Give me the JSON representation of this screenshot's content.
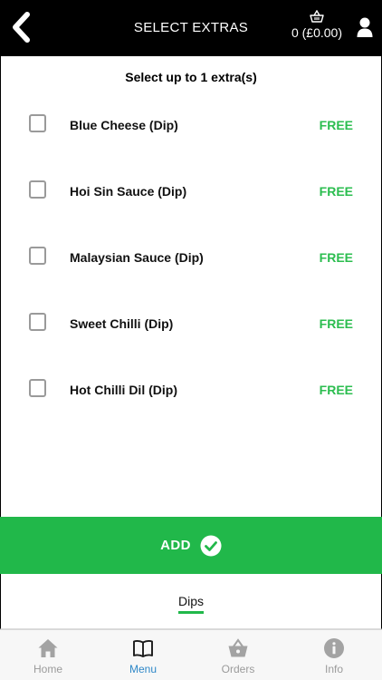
{
  "header": {
    "title": "SELECT EXTRAS",
    "basket_text": "0 (£0.00)",
    "back_icon": "chevron-left-icon",
    "basket_icon": "basket-icon",
    "user_icon": "user-icon"
  },
  "selection": {
    "subtitle": "Select up to 1 extra(s)",
    "extras": [
      {
        "name": "Blue Cheese (Dip)",
        "price": "FREE",
        "checked": false
      },
      {
        "name": "Hoi Sin Sauce (Dip)",
        "price": "FREE",
        "checked": false
      },
      {
        "name": "Malaysian Sauce (Dip)",
        "price": "FREE",
        "checked": false
      },
      {
        "name": "Sweet Chilli (Dip)",
        "price": "FREE",
        "checked": false
      },
      {
        "name": "Hot Chilli Dil (Dip)",
        "price": "FREE",
        "checked": false
      }
    ]
  },
  "add_button": {
    "label": "ADD",
    "icon": "check-circle-icon"
  },
  "category": {
    "label": "Dips"
  },
  "tabs": [
    {
      "label": "Home",
      "icon": "home-icon",
      "active": false
    },
    {
      "label": "Menu",
      "icon": "book-icon",
      "active": true
    },
    {
      "label": "Orders",
      "icon": "basket-icon",
      "active": false
    },
    {
      "label": "Info",
      "icon": "info-icon",
      "active": false
    }
  ],
  "colors": {
    "header_bg": "#000000",
    "accent_green": "#21b84a",
    "price_green": "#2bbd4f",
    "tab_active": "#2f88c8",
    "tab_inactive": "#9b9b9b"
  }
}
